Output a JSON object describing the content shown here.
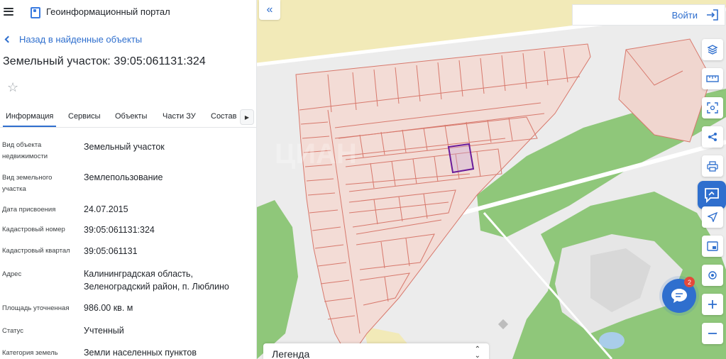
{
  "header": {
    "portal_title": "Геоинформационный портал"
  },
  "nav": {
    "back_label": "Назад в найденные объекты"
  },
  "object": {
    "title": "Земельный участок: 39:05:061131:324"
  },
  "tabs": [
    {
      "label": "Информация",
      "active": true
    },
    {
      "label": "Сервисы"
    },
    {
      "label": "Объекты"
    },
    {
      "label": "Части ЗУ"
    },
    {
      "label": "Состав"
    }
  ],
  "attributes": [
    {
      "label": "Вид объекта недвижимости",
      "value": "Земельный участок"
    },
    {
      "label": "Вид земельного участка",
      "value": "Землепользование"
    },
    {
      "label": "Дата присвоения",
      "value": "24.07.2015"
    },
    {
      "label": "Кадастровый номер",
      "value": "39:05:061131:324"
    },
    {
      "label": "Кадастровый квартал",
      "value": "39:05:061131"
    },
    {
      "label": "Адрес",
      "value": "Калининградская область, Зеленоградский район, п. Люблино"
    },
    {
      "label": "Площадь уточненная",
      "value": "986.00 кв. м"
    },
    {
      "label": "Статус",
      "value": "Учтенный"
    },
    {
      "label": "Категория земель",
      "value": "Земли населенных пунктов"
    }
  ],
  "map": {
    "login_label": "Войти",
    "legend_label": "Легенда",
    "chat_badge": "2",
    "tools": [
      "layers-icon",
      "ruler-icon",
      "select-area-icon",
      "share-icon",
      "print-icon",
      "feedback-icon",
      "locate-icon",
      "inset-map-icon",
      "geolocation-icon",
      "zoom-in-icon",
      "zoom-out-icon"
    ],
    "colors": {
      "accent": "#2f6fce",
      "parcel_line": "#d7786c",
      "parcel_fill": "#f3dcd6",
      "selected": "#6a1b9a",
      "greenery": "#8fc77a",
      "sand": "#f2eab8",
      "water": "#a9cdea"
    }
  }
}
